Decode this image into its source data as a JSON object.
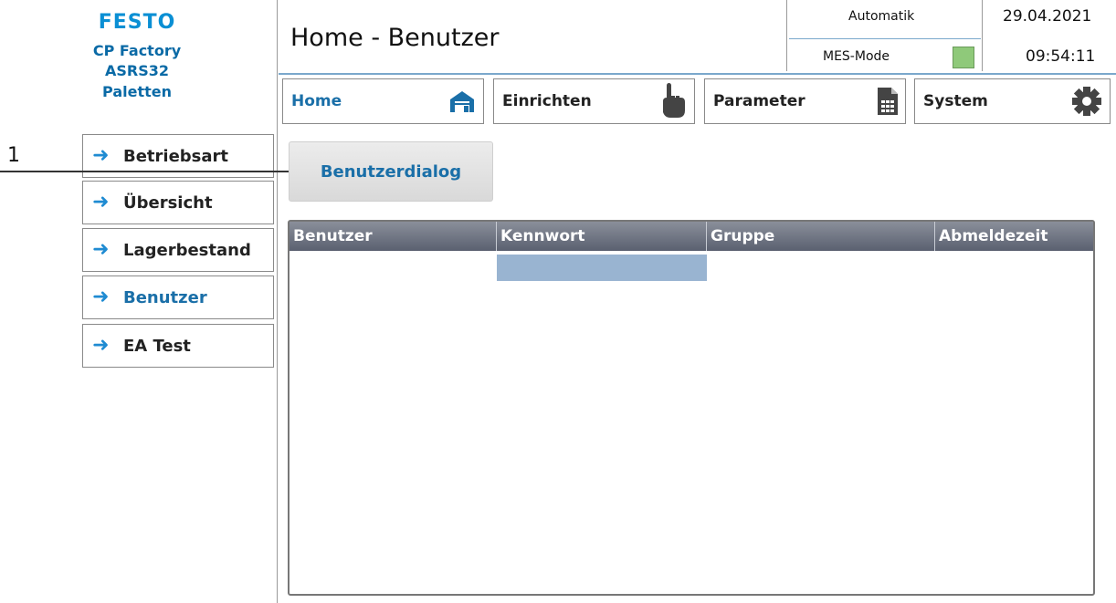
{
  "brand": {
    "logo": "FESTO",
    "line1": "CP Factory",
    "line2": "ASRS32",
    "line3": "Paletten"
  },
  "header": {
    "title": "Home - Benutzer",
    "mode": "Automatik",
    "mes_label": "MES-Mode",
    "mes_status_color": "#8fc97a",
    "date": "29.04.2021",
    "time": "09:54:11"
  },
  "nav": [
    {
      "label": "Home",
      "icon": "house-icon",
      "active": true
    },
    {
      "label": "Einrichten",
      "icon": "hand-pointer-icon",
      "active": false
    },
    {
      "label": "Parameter",
      "icon": "document-icon",
      "active": false
    },
    {
      "label": "System",
      "icon": "gear-icon",
      "active": false
    }
  ],
  "sidebar": {
    "items": [
      {
        "label": "Betriebsart"
      },
      {
        "label": "Übersicht"
      },
      {
        "label": "Lagerbestand"
      },
      {
        "label": "Benutzer",
        "active": true
      },
      {
        "label": "EA Test"
      }
    ]
  },
  "callout": {
    "number": "1"
  },
  "dialog_button": {
    "label": "Benutzerdialog"
  },
  "table": {
    "columns": [
      "Benutzer",
      "Kennwort",
      "Gruppe",
      "Abmeldezeit"
    ],
    "rows": []
  },
  "colors": {
    "accent": "#1a6fa8",
    "arrow": "#1f8bd2",
    "table_header": "#5a6070",
    "selection": "#99b4d1"
  }
}
